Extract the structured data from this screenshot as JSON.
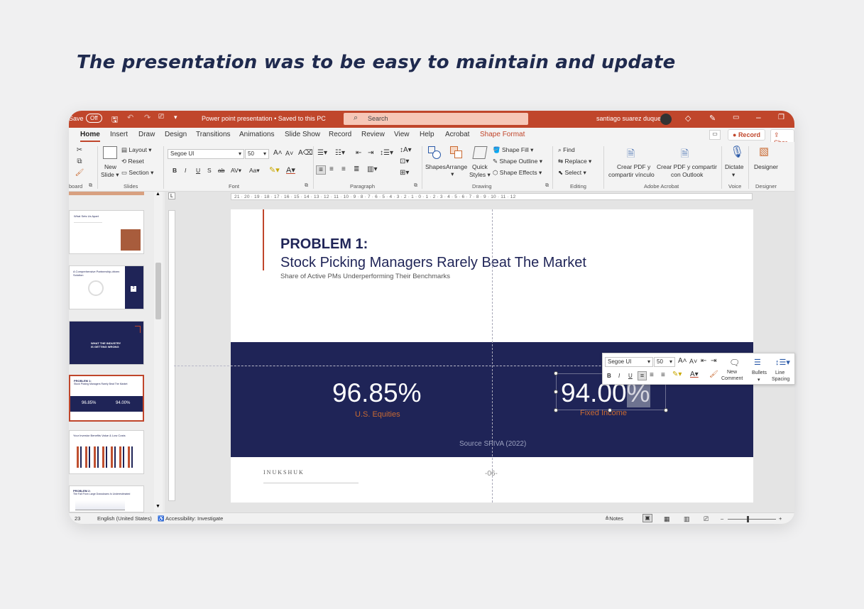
{
  "headline": "The presentation was to be easy to maintain and update",
  "titlebar": {
    "autosave": "Save",
    "autosave_state": "Off",
    "doc_title": "Power point presentation • Saved to this PC",
    "search_placeholder": "Search",
    "user": "santiago suarez duque"
  },
  "tabs": [
    "Home",
    "Insert",
    "Draw",
    "Design",
    "Transitions",
    "Animations",
    "Slide Show",
    "Record",
    "Review",
    "View",
    "Help",
    "Acrobat",
    "Shape Format"
  ],
  "record_label": "Record",
  "share_label": "Shar",
  "ribbon": {
    "clipboard": "board",
    "new_slide": "New",
    "slide_dd": "Slide",
    "layout": "Layout",
    "reset": "Reset",
    "section": "Section",
    "slides_group": "Slides",
    "font_name": "Segoe UI",
    "font_size": "50",
    "font_group": "Font",
    "bold": "B",
    "italic": "I",
    "underline": "U",
    "shadow": "S",
    "strike": "ab",
    "spacing": "AV",
    "case": "Aa",
    "paragraph_group": "Paragraph",
    "shapes": "Shapes",
    "arrange": "Arrange",
    "quick": "Quick",
    "styles": "Styles",
    "shape_fill": "Shape Fill",
    "shape_outline": "Shape Outline",
    "shape_effects": "Shape Effects",
    "drawing_group": "Drawing",
    "find": "Find",
    "replace": "Replace",
    "select": "Select",
    "editing_group": "Editing",
    "pdf1_a": "Crear PDF y",
    "pdf1_b": "compartir vínculo",
    "pdf2_a": "Crear PDF y compartir",
    "pdf2_b": "con Outlook",
    "acrobat_group": "Adobe Acrobat",
    "dictate": "Dictate",
    "voice_group": "Voice",
    "designer": "Designer",
    "designer_group": "Designer"
  },
  "ruler_text": "21 · 20 · 19 · 18 · 17 · 16 · 15 · 14 · 13 · 12 · 11 · 10 · 9 · 8 · 7 · 6 · 5 · 4 · 3 · 2 · 1 · 0 · 1 · 2 · 3 · 4 · 5 · 6 · 7 · 8 · 9 · 10 · 11 · 12",
  "thumbs": [
    {
      "title": "What Sets Us Apart"
    },
    {
      "title": "A Comprehensive Partnership-driven Solution",
      "num": "3"
    },
    {
      "title": "WHAT THE INDUSTRY IS GETTING WRONG"
    },
    {
      "title": "PROBLEM 1:",
      "sub": "Stock Picking Managers Rarely Beat The Market",
      "a": "96.85%",
      "b": "94.00%"
    },
    {
      "title": "Your Investor Benefits Value & Low Costs"
    },
    {
      "title": "PROBLEM 2:",
      "sub": "The Fall From Large Drawdowns Is Underestimated"
    }
  ],
  "slide": {
    "title": "PROBLEM 1:",
    "subtitle": "Stock Picking Managers Rarely Beat The Market",
    "description": "Share of Active PMs Underperforming Their Benchmarks",
    "stat1_value": "96.85%",
    "stat1_label": "U.S. Equities",
    "stat2_value": "94.00",
    "stat2_pct": "%",
    "stat2_label": "Fixed Income",
    "source": "Source SPIVA (2022)",
    "logo": "INUKSHUK",
    "page": "-06-"
  },
  "mini_toolbar": {
    "font": "Segoe UI",
    "size": "50",
    "new_comment_a": "New",
    "new_comment_b": "Comment",
    "bullets": "Bullets",
    "line_a": "Line",
    "line_b": "Spacing"
  },
  "status": {
    "slide_count": "23",
    "language": "English (United States)",
    "accessibility": "Accessibility: Investigate",
    "notes": "Notes"
  },
  "colors": {
    "accent": "#c0462b",
    "navy": "#1f2457",
    "orange_text": "#c96a32"
  }
}
